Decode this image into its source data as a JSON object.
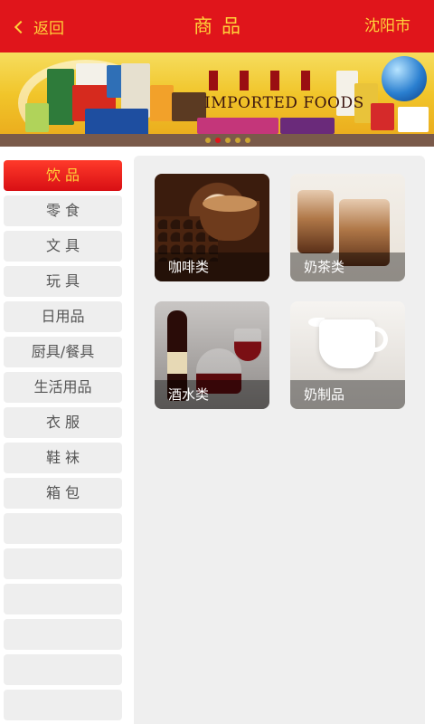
{
  "header": {
    "back_label": "返回",
    "title": "商品",
    "city": "沈阳市"
  },
  "banner": {
    "headline": "IMPORTED FOODS",
    "slide_count": 5,
    "active_slide": 1
  },
  "sidebar": {
    "items": [
      {
        "label": "饮 品",
        "active": true
      },
      {
        "label": "零 食",
        "active": false
      },
      {
        "label": "文 具",
        "active": false
      },
      {
        "label": "玩 具",
        "active": false
      },
      {
        "label": "日用品",
        "active": false
      },
      {
        "label": "厨具/餐具",
        "active": false
      },
      {
        "label": "生活用品",
        "active": false
      },
      {
        "label": "衣 服",
        "active": false
      },
      {
        "label": "鞋 袜",
        "active": false
      },
      {
        "label": "箱 包",
        "active": false
      },
      {
        "label": "",
        "active": false
      },
      {
        "label": "",
        "active": false
      },
      {
        "label": "",
        "active": false
      },
      {
        "label": "",
        "active": false
      },
      {
        "label": "",
        "active": false
      },
      {
        "label": "",
        "active": false
      }
    ]
  },
  "subcategories": [
    {
      "label": "咖啡类",
      "image": "coffee"
    },
    {
      "label": "奶茶类",
      "image": "milk-tea"
    },
    {
      "label": "酒水类",
      "image": "wine"
    },
    {
      "label": "奶制品",
      "image": "dairy"
    }
  ],
  "colors": {
    "header_bg": "#e0151b",
    "header_text": "#ffd23a",
    "active_item_bg": "#d80f14",
    "inactive_item_bg": "#eeeeee",
    "panel_bg": "#efefef"
  }
}
